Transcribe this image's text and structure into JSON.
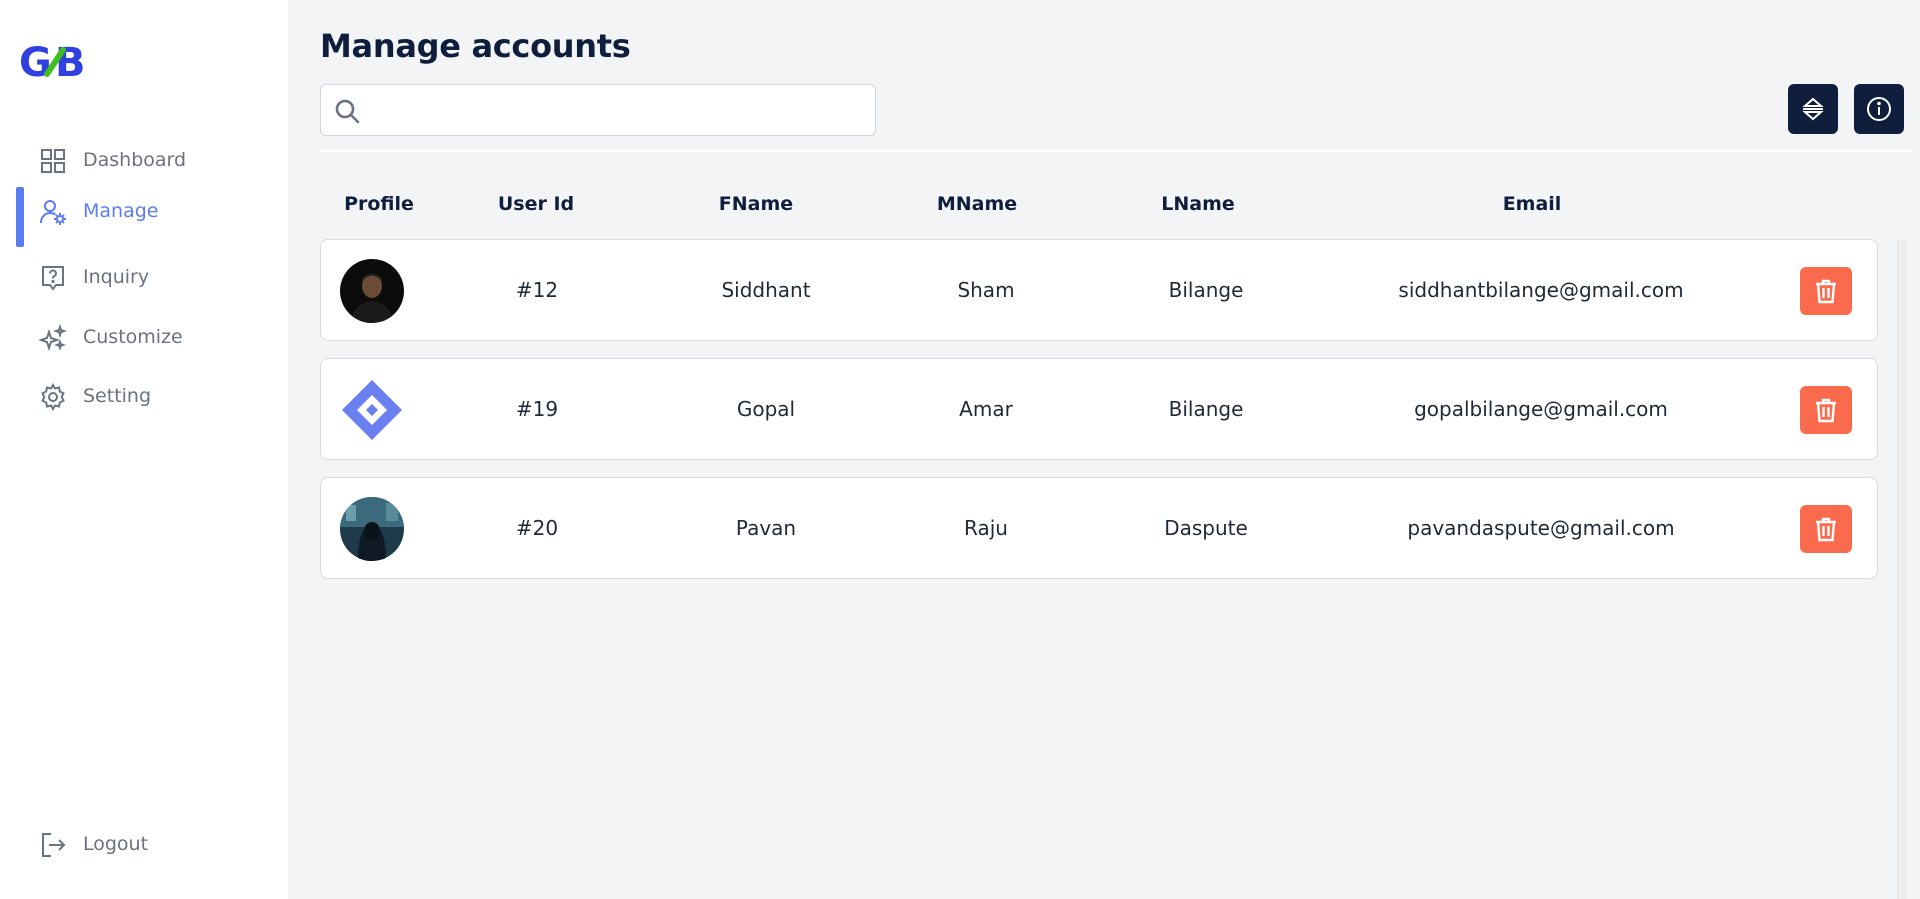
{
  "sidebar": {
    "logo_text": "GB",
    "items": [
      {
        "label": "Dashboard",
        "icon": "grid-icon"
      },
      {
        "label": "Manage",
        "icon": "user-gear-icon",
        "active": true
      },
      {
        "label": "Inquiry",
        "icon": "question-icon"
      },
      {
        "label": "Customize",
        "icon": "sparkles-icon"
      },
      {
        "label": "Setting",
        "icon": "gear-icon"
      }
    ],
    "logout_label": "Logout"
  },
  "main": {
    "title": "Manage accounts",
    "search": {
      "value": "",
      "placeholder": ""
    },
    "table": {
      "headers": [
        "Profile",
        "User Id",
        "FName",
        "MName",
        "LName",
        "Email"
      ],
      "rows": [
        {
          "user_id": "#12",
          "fname": "Siddhant",
          "mname": "Sham",
          "lname": "Bilange",
          "email": "siddhantbilange@gmail.com",
          "avatar": "person-photo"
        },
        {
          "user_id": "#19",
          "fname": "Gopal",
          "mname": "Amar",
          "lname": "Bilange",
          "email": "gopalbilange@gmail.com",
          "avatar": "diamond-logo"
        },
        {
          "user_id": "#20",
          "fname": "Pavan",
          "mname": "Raju",
          "lname": "Daspute",
          "email": "pavandaspute@gmail.com",
          "avatar": "hooded-figure-photo"
        }
      ]
    }
  },
  "colors": {
    "accent": "#5b7cf0",
    "dark_button": "#0f1e3c",
    "delete": "#fa6a4d",
    "muted_text": "#6b7280"
  }
}
